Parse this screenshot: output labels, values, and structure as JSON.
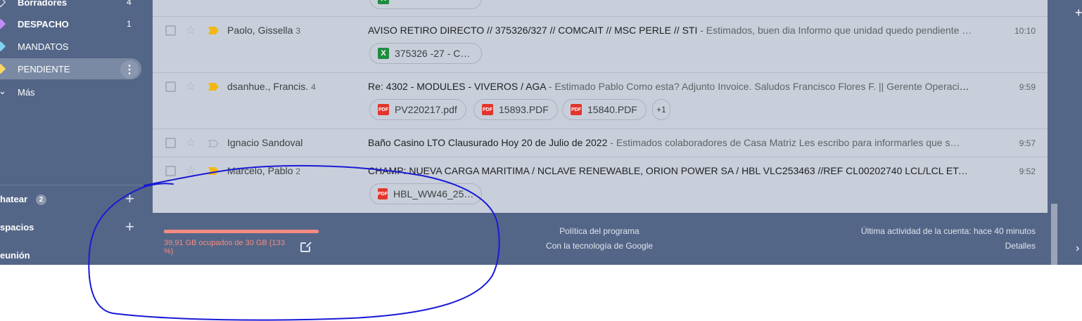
{
  "sidebar": {
    "items": [
      {
        "label": "Borradores",
        "count": "4",
        "color": "#ffffff"
      },
      {
        "label": "DESPACHO",
        "count": "1",
        "color": "#c58af9"
      },
      {
        "label": "MANDATOS",
        "count": "",
        "color": "#7fd3f0"
      },
      {
        "label": "PENDIENTE",
        "count": "",
        "color": "#fdd663"
      },
      {
        "label": "Más",
        "count": ""
      }
    ],
    "more_glyph": "⋮",
    "sections": [
      {
        "label": "hatear",
        "badge": "2",
        "add": "+"
      },
      {
        "label": "spacios",
        "add": "+"
      },
      {
        "label": "eunión"
      }
    ]
  },
  "emails": [
    {
      "sender": "Paolo, Gissella",
      "count": "3",
      "important": true,
      "subject": "AVISO RETIRO DIRECTO // 375326/327 // COMCAIT // MSC PERLE // STI",
      "snippet": " - Estimados, buen dia Informo que unidad quedo pendiente …",
      "time": "10:10",
      "attachments": [
        {
          "name": "375326 -27 - C…",
          "type": "xls"
        }
      ]
    },
    {
      "sender": "dsanhue., Francis.",
      "count": "4",
      "important": true,
      "subject": "Re: 4302 - MODULES - VIVEROS / AGA",
      "snippet": " - Estimado Pablo Como esta? Adjunto Invoice. Saludos Francisco Flores F. || Gerente Operacio…",
      "time": "9:59",
      "attachments": [
        {
          "name": "PV220217.pdf",
          "type": "pdf"
        },
        {
          "name": "15893.PDF",
          "type": "pdf"
        },
        {
          "name": "15840.PDF",
          "type": "pdf"
        }
      ],
      "more": "+1"
    },
    {
      "sender": "Ignacio Sandoval",
      "count": "",
      "important": false,
      "subject": "Baño Casino LTO Clausurado Hoy 20 de Julio de 2022",
      "snippet": " - Estimados colaboradores de Casa Matriz Les escribo para informarles que s…",
      "time": "9:57",
      "attachments": []
    },
    {
      "sender": "Marcelo, Pablo",
      "count": "2",
      "important": true,
      "subject": "CHAMP: NUEVA CARGA MARITIMA / NCLAVE RENEWABLE, ORION POWER SA / HBL VLC253463 //REF CL00202740 LCL/LCL ETA 1…",
      "snippet": "",
      "time": "9:52",
      "attachments": [
        {
          "name": "HBL_WW46_25…",
          "type": "pdf"
        }
      ]
    }
  ],
  "file_icon_text": {
    "pdf": "PDF",
    "xls": "X"
  },
  "footer": {
    "storage_used": "39,91 GB ocupados de 30 GB (133 %)",
    "storage_fraction": 1.0,
    "policy": "Política del programa",
    "powered": "Con la tecnología de Google",
    "activity": "Última actividad de la cuenta: hace 40 minutos",
    "details": "Detalles"
  },
  "rail": {
    "plus": "+",
    "chevron": "›"
  },
  "colors": {
    "sidebar_bg": "#546687",
    "list_bg": "#c9cfda",
    "important": "#f3b715",
    "storage_warning": "#f28b82",
    "annotation": "#1a1ad6"
  }
}
